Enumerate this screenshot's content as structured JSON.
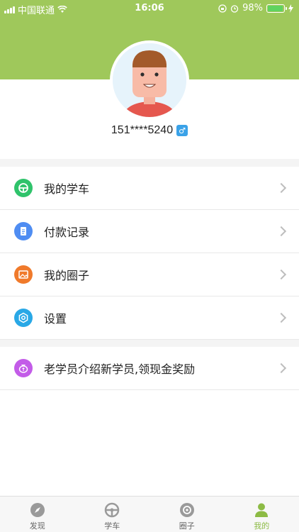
{
  "status_bar": {
    "carrier": "中国联通",
    "time": "16:06",
    "battery": "98%",
    "battery_level": 0.98
  },
  "profile": {
    "phone": "151****5240",
    "gender_symbol": "♂"
  },
  "menu": [
    {
      "label": "我的学车",
      "icon": "steering-wheel-icon",
      "color": "#2fc36b"
    },
    {
      "label": "付款记录",
      "icon": "document-icon",
      "color": "#4f8df2"
    },
    {
      "label": "我的圈子",
      "icon": "image-icon",
      "color": "#f07a2b"
    },
    {
      "label": "设置",
      "icon": "gear-icon",
      "color": "#29a8e6"
    },
    {
      "label": "老学员介绍新学员,领现金奖励",
      "icon": "money-bag-icon",
      "color": "#c35ce8"
    }
  ],
  "tabs": [
    {
      "label": "发现",
      "icon": "compass-icon",
      "active": false
    },
    {
      "label": "学车",
      "icon": "steering-wheel-icon",
      "active": false
    },
    {
      "label": "圈子",
      "icon": "circle-icon",
      "active": false
    },
    {
      "label": "我的",
      "icon": "person-icon",
      "active": true
    }
  ],
  "colors": {
    "header": "#9fc85b",
    "active_tab": "#8dbb45"
  }
}
